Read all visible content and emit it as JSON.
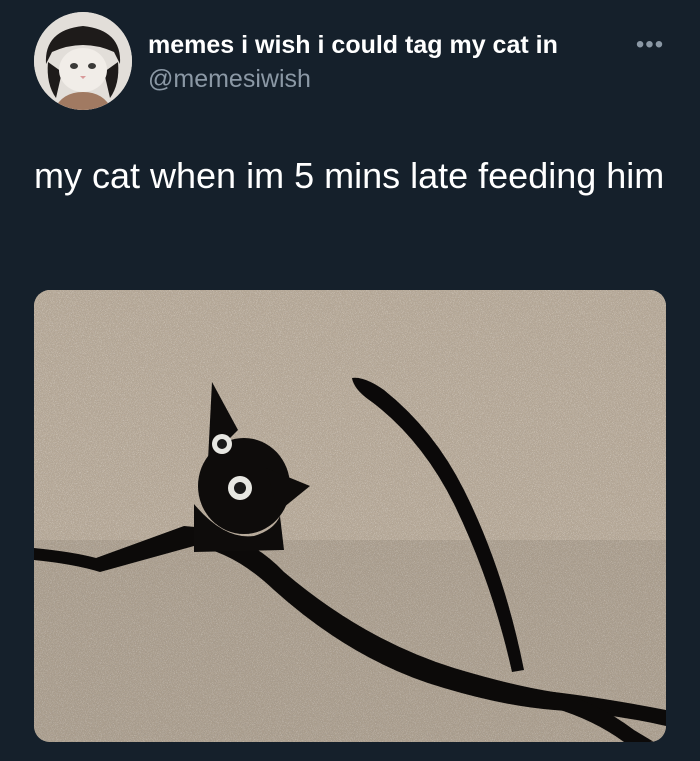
{
  "tweet": {
    "display_name": "memes i wish i could tag my cat in",
    "handle": "@memesiwish",
    "more_icon": "more-horizontal-icon",
    "text": "my cat when im 5 mins late feeding him",
    "media_description": "black cat peeking through a slit in carpet"
  },
  "colors": {
    "background": "#15202b",
    "name": "#ffffff",
    "handle": "#8b98a5"
  }
}
